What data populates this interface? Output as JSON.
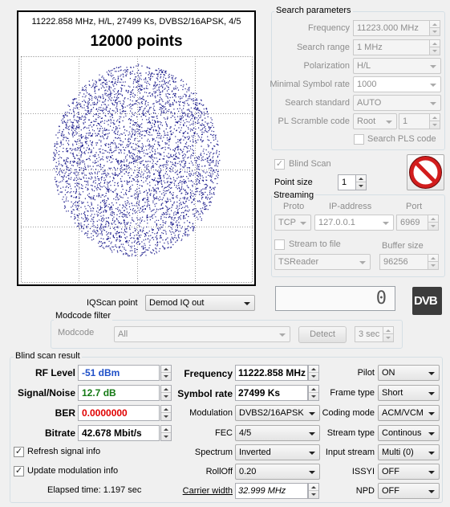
{
  "plot": {
    "header": "11222.858 MHz, H/L, 27499 Ks, DVBS2/16APSK, 4/5",
    "points_title": "12000 points",
    "dot_color": "#1c1c8c"
  },
  "search": {
    "group_label": "Search parameters",
    "frequency_label": "Frequency",
    "frequency_value": "11223.000 MHz",
    "range_label": "Search range",
    "range_value": "1 MHz",
    "polarization_label": "Polarization",
    "polarization_value": "H/L",
    "min_sr_label": "Minimal Symbol rate",
    "min_sr_value": "1000",
    "standard_label": "Search standard",
    "standard_value": "AUTO",
    "pls_label": "PL Scramble code",
    "pls_mode": "Root",
    "pls_value": "1",
    "pls_search_label": "Search PLS code"
  },
  "blind": {
    "blind_scan_label": "Blind Scan",
    "point_size_label": "Point size",
    "point_size_value": "1"
  },
  "streaming": {
    "group_label": "Streaming",
    "proto_label": "Proto",
    "ip_label": "IP-address",
    "port_label": "Port",
    "proto_value": "TCP",
    "ip_value": "127.0.0.1",
    "port_value": "6969",
    "stream_to_file_label": "Stream to file",
    "buffer_label": "Buffer size",
    "file_format_value": "TSReader",
    "buffer_value": "96256"
  },
  "iqscan": {
    "label": "IQScan point",
    "value": "Demod IQ out",
    "counter": "0",
    "logo_text": "DVB"
  },
  "modcode": {
    "group_label": "Modcode filter",
    "label": "Modcode",
    "value": "All",
    "detect_label": "Detect",
    "timeout_value": "3 sec"
  },
  "result": {
    "group_label": "Blind scan result",
    "rf_level_label": "RF Level",
    "rf_level_value": "-51 dBm",
    "snr_label": "Signal/Noise",
    "snr_value": "12.7 dB",
    "ber_label": "BER",
    "ber_value": "0.0000000",
    "bitrate_label": "Bitrate",
    "bitrate_value": "42.678 Mbit/s",
    "refresh_label": "Refresh signal info",
    "update_label": "Update modulation info",
    "elapsed": "Elapsed time: 1.197 sec",
    "frequency_label": "Frequency",
    "frequency_value": "11222.858 MHz",
    "symbol_rate_label": "Symbol rate",
    "symbol_rate_value": "27499 Ks",
    "modulation_label": "Modulation",
    "modulation_value": "DVBS2/16APSK",
    "fec_label": "FEC",
    "fec_value": "4/5",
    "spectrum_label": "Spectrum",
    "spectrum_value": "Inverted",
    "rolloff_label": "RollOff",
    "rolloff_value": "0.20",
    "carrier_width_label": "Carrier width",
    "carrier_width_value": "32.999 MHz",
    "pilot_label": "Pilot",
    "pilot_value": "ON",
    "frame_type_label": "Frame type",
    "frame_type_value": "Short",
    "coding_mode_label": "Coding mode",
    "coding_mode_value": "ACM/VCM",
    "stream_type_label": "Stream type",
    "stream_type_value": "Continous",
    "input_stream_label": "Input stream",
    "input_stream_value": "Multi (0)",
    "issyi_label": "ISSYI",
    "issyi_value": "OFF",
    "npd_label": "NPD",
    "npd_value": "OFF"
  },
  "colors": {
    "rf_level": "#1f50c8",
    "snr": "#157a15",
    "ber": "#e00000",
    "stop_red": "#d21d1d"
  }
}
